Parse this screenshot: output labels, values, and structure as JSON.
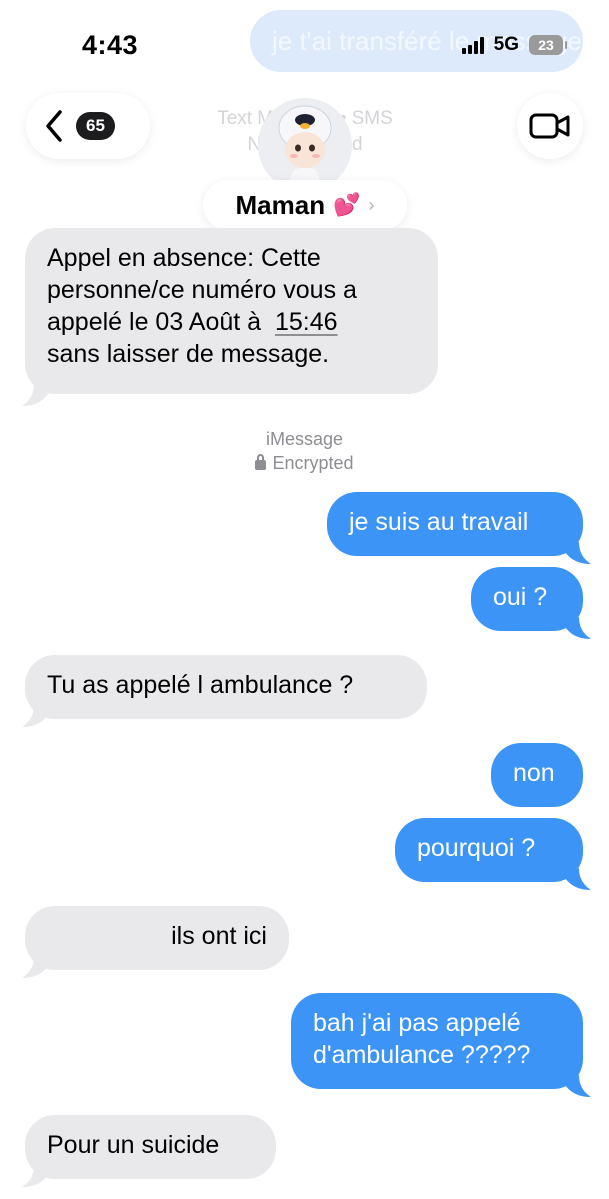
{
  "status": {
    "time": "4:43",
    "network": "5G",
    "battery": "23",
    "ghost_message": "je t'ai transféré le message"
  },
  "header": {
    "back_count": "65",
    "faint_line1": "Text Message • SMS",
    "faint_line2": "Not Delivered",
    "contact_name": "Maman",
    "contact_emoji": "💕",
    "chevron": "›"
  },
  "messages": {
    "m1_line1": "Appel en absence: Cette",
    "m1_line2": "personne/ce numéro vous a",
    "m1_line3a": "appelé le 03 Août à",
    "m1_line3b": "15:46",
    "m1_line4": "sans laisser de message.",
    "service": "iMessage",
    "encrypted": "Encrypted",
    "m2": "je suis au travail",
    "m3": "oui ?",
    "m4": "Tu as appelé l ambulance ?",
    "m5": "non",
    "m6": "pourquoi ?",
    "m7": "ils ont ici",
    "m8_line1": "bah j'ai pas appelé",
    "m8_line2": "d'ambulance ?????",
    "m9": "Pour un suicide"
  },
  "colors": {
    "outgoing": "#3b94f6",
    "incoming": "#e9e9eb"
  },
  "icons": [
    "back-chevron-icon",
    "video-camera-icon",
    "signal-icon",
    "battery-icon",
    "lock-icon",
    "contact-avatar"
  ]
}
